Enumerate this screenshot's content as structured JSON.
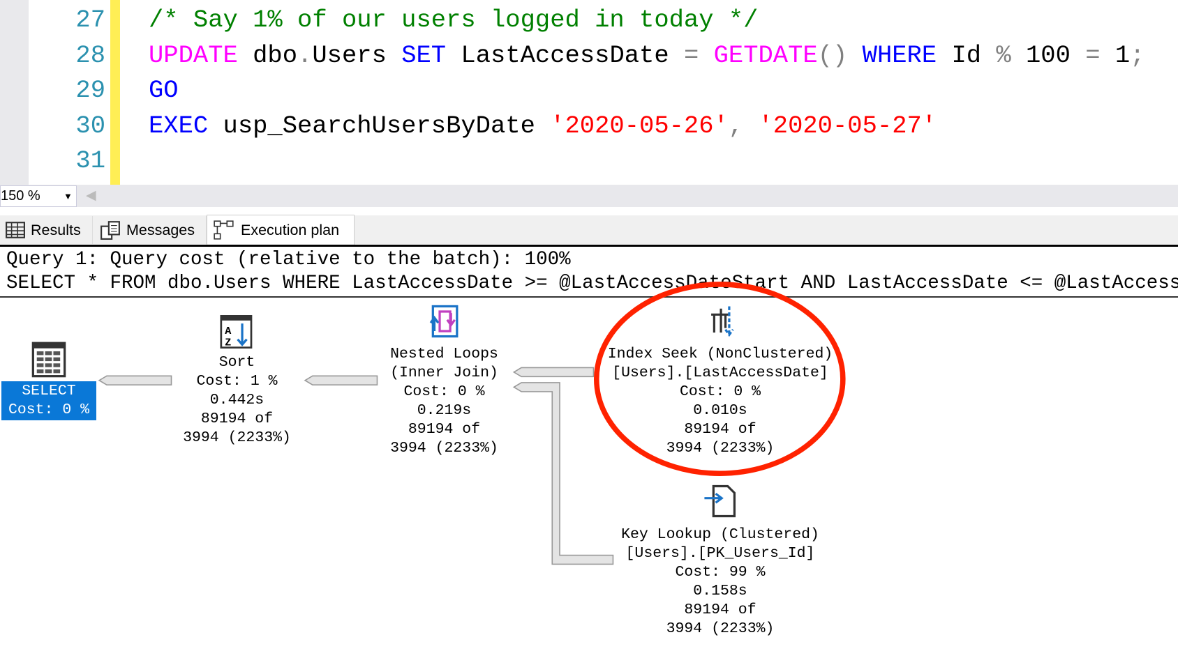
{
  "editor": {
    "lines": [
      {
        "num": "27",
        "tokens": [
          {
            "t": "/* Say 1% of our users logged in today */",
            "c": "cm"
          }
        ]
      },
      {
        "num": "28",
        "tokens": [
          {
            "t": "UPDATE",
            "c": "fn"
          },
          {
            "t": " dbo",
            "c": ""
          },
          {
            "t": ".",
            "c": "op"
          },
          {
            "t": "Users ",
            "c": ""
          },
          {
            "t": "SET",
            "c": "kw"
          },
          {
            "t": " LastAccessDate ",
            "c": ""
          },
          {
            "t": "=",
            "c": "op"
          },
          {
            "t": " ",
            "c": ""
          },
          {
            "t": "GETDATE",
            "c": "fn"
          },
          {
            "t": "()",
            "c": "op"
          },
          {
            "t": " ",
            "c": ""
          },
          {
            "t": "WHERE",
            "c": "kw"
          },
          {
            "t": " Id ",
            "c": ""
          },
          {
            "t": "%",
            "c": "op"
          },
          {
            "t": " 100 ",
            "c": ""
          },
          {
            "t": "=",
            "c": "op"
          },
          {
            "t": " 1",
            "c": ""
          },
          {
            "t": ";",
            "c": "op"
          }
        ]
      },
      {
        "num": "29",
        "tokens": [
          {
            "t": "GO",
            "c": "kw"
          }
        ]
      },
      {
        "num": "30",
        "tokens": [
          {
            "t": "EXEC",
            "c": "kw"
          },
          {
            "t": " usp_SearchUsersByDate ",
            "c": ""
          },
          {
            "t": "'2020-05-26'",
            "c": "str"
          },
          {
            "t": ", ",
            "c": "op"
          },
          {
            "t": "'2020-05-27'",
            "c": "str"
          }
        ]
      },
      {
        "num": "31",
        "tokens": []
      }
    ]
  },
  "zoom": {
    "value": "150 %"
  },
  "tabs": [
    {
      "label": "Results",
      "icon": "grid-icon"
    },
    {
      "label": "Messages",
      "icon": "messages-icon"
    },
    {
      "label": "Execution plan",
      "icon": "execution-plan-icon",
      "selected": true
    }
  ],
  "plan": {
    "query_header": "Query 1: Query cost (relative to the batch): 100%",
    "query_text": "SELECT * FROM dbo.Users WHERE LastAccessDate >= @LastAccessDateStart AND LastAccessDate <= @LastAccess",
    "nodes": {
      "select": {
        "name": "SELECT",
        "cost": "Cost: 0 %"
      },
      "sort": {
        "name": "Sort",
        "cost": "Cost: 1 %",
        "time": "0.442s",
        "rows": "89194 of",
        "est": "3994 (2233%)"
      },
      "nested": {
        "name": "Nested Loops",
        "sub": "(Inner Join)",
        "cost": "Cost: 0 %",
        "time": "0.219s",
        "rows": "89194 of",
        "est": "3994 (2233%)"
      },
      "seek": {
        "name": "Index Seek (NonClustered)",
        "sub": "[Users].[LastAccessDate]",
        "cost": "Cost: 0 %",
        "time": "0.010s",
        "rows": "89194 of",
        "est": "3994 (2233%)"
      },
      "lookup": {
        "name": "Key Lookup (Clustered)",
        "sub": "[Users].[PK_Users_Id]",
        "cost": "Cost: 99 %",
        "time": "0.158s",
        "rows": "89194 of",
        "est": "3994 (2233%)"
      }
    },
    "highlight_color": "#ff2200",
    "select_color": "#0a78d7"
  }
}
